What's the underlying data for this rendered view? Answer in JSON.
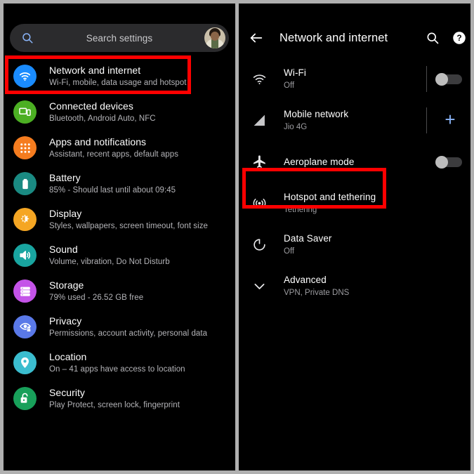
{
  "left_panel": {
    "search": {
      "icon": "search-icon",
      "placeholder": "Search settings",
      "avatar": "user-avatar"
    },
    "items": [
      {
        "title": "Network and internet",
        "subtitle": "Wi-Fi, mobile, data usage and hotspot",
        "icon": "wifi-icon",
        "color": "#1a8cff",
        "highlighted": true
      },
      {
        "title": "Connected devices",
        "subtitle": "Bluetooth, Android Auto, NFC",
        "icon": "cast-devices-icon",
        "color": "#4caf23",
        "highlighted": false
      },
      {
        "title": "Apps and notifications",
        "subtitle": "Assistant, recent apps, default apps",
        "icon": "apps-grid-icon",
        "color": "#f57c1f",
        "highlighted": false
      },
      {
        "title": "Battery",
        "subtitle": "85% - Should last until about 09:45",
        "icon": "battery-icon",
        "color": "#1a8a82",
        "highlighted": false
      },
      {
        "title": "Display",
        "subtitle": "Styles, wallpapers, screen timeout, font size",
        "icon": "brightness-icon",
        "color": "#f5a623",
        "highlighted": false
      },
      {
        "title": "Sound",
        "subtitle": "Volume, vibration, Do Not Disturb",
        "icon": "volume-icon",
        "color": "#19a5a0",
        "highlighted": false
      },
      {
        "title": "Storage",
        "subtitle": "79% used - 26.52 GB free",
        "icon": "storage-icon",
        "color": "#c453e8",
        "highlighted": false
      },
      {
        "title": "Privacy",
        "subtitle": "Permissions, account activity, personal data",
        "icon": "privacy-eye-lock-icon",
        "color": "#5a79e8",
        "highlighted": false
      },
      {
        "title": "Location",
        "subtitle": "On – 41 apps have access to location",
        "icon": "location-pin-icon",
        "color": "#3bbdcf",
        "highlighted": false
      },
      {
        "title": "Security",
        "subtitle": "Play Protect, screen lock, fingerprint",
        "icon": "unlocked-padlock-icon",
        "color": "#18a05a",
        "highlighted": false
      }
    ]
  },
  "right_panel": {
    "header": {
      "back": "back-arrow-icon",
      "title": "Network and internet",
      "search": "search-icon",
      "help": "help-icon"
    },
    "items": [
      {
        "title": "Wi-Fi",
        "subtitle": "Off",
        "icon": "wifi-icon",
        "control": "toggle",
        "toggle_on": false,
        "divider": true,
        "highlighted": false
      },
      {
        "title": "Mobile network",
        "subtitle": "Jio 4G",
        "icon": "signal-bars-icon",
        "control": "plus",
        "plus_label": "+",
        "divider": true,
        "highlighted": false
      },
      {
        "title": "Aeroplane mode",
        "subtitle": "",
        "icon": "airplane-icon",
        "control": "toggle",
        "toggle_on": false,
        "divider": false,
        "highlighted": false
      },
      {
        "title": "Hotspot and tethering",
        "subtitle": "Tethering",
        "icon": "hotspot-icon",
        "control": "none",
        "divider": false,
        "highlighted": true
      },
      {
        "title": "Data Saver",
        "subtitle": "Off",
        "icon": "data-saver-icon",
        "control": "none",
        "divider": false,
        "highlighted": false
      },
      {
        "title": "Advanced",
        "subtitle": "VPN, Private DNS",
        "icon": "chevron-down-icon",
        "control": "none",
        "divider": false,
        "highlighted": false
      }
    ]
  },
  "annotation": {
    "highlight_color": "#ff0000"
  }
}
